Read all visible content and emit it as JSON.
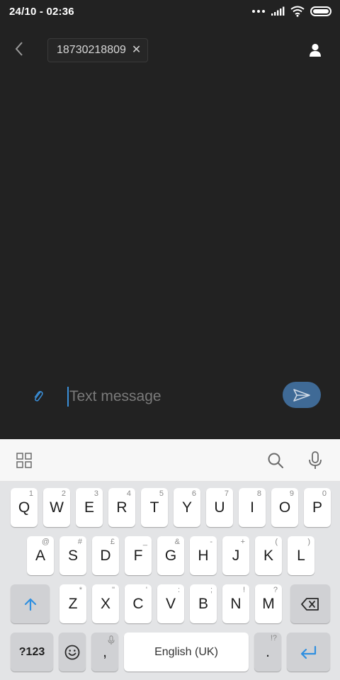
{
  "status_bar": {
    "time": "24/10 - 02:36"
  },
  "header": {
    "recipient": "18730218809",
    "remove_symbol": "✕"
  },
  "composer": {
    "placeholder": "Text message"
  },
  "keyboard": {
    "row1": [
      {
        "key": "Q",
        "sub": "1"
      },
      {
        "key": "W",
        "sub": "2"
      },
      {
        "key": "E",
        "sub": "3"
      },
      {
        "key": "R",
        "sub": "4"
      },
      {
        "key": "T",
        "sub": "5"
      },
      {
        "key": "Y",
        "sub": "6"
      },
      {
        "key": "U",
        "sub": "7"
      },
      {
        "key": "I",
        "sub": "8"
      },
      {
        "key": "O",
        "sub": "9"
      },
      {
        "key": "P",
        "sub": "0"
      }
    ],
    "row2": [
      {
        "key": "A",
        "sub": "@"
      },
      {
        "key": "S",
        "sub": "#"
      },
      {
        "key": "D",
        "sub": "£"
      },
      {
        "key": "F",
        "sub": "_"
      },
      {
        "key": "G",
        "sub": "&"
      },
      {
        "key": "H",
        "sub": "-"
      },
      {
        "key": "J",
        "sub": "+"
      },
      {
        "key": "K",
        "sub": "("
      },
      {
        "key": "L",
        "sub": ")"
      }
    ],
    "row3": [
      {
        "key": "Z",
        "sub": "*"
      },
      {
        "key": "X",
        "sub": "\""
      },
      {
        "key": "C",
        "sub": "'"
      },
      {
        "key": "V",
        "sub": ":"
      },
      {
        "key": "B",
        "sub": ";"
      },
      {
        "key": "N",
        "sub": "!"
      },
      {
        "key": "M",
        "sub": "?"
      }
    ],
    "symbols_label": "?123",
    "comma_label": ",",
    "space_label": "English (UK)",
    "period_label": ".",
    "period_sub": "!?"
  },
  "colors": {
    "background": "#222222",
    "send_button": "#3f6a96",
    "accent_blue": "#2f8fe0",
    "keyboard_bg": "#e3e4e6"
  },
  "icons": {
    "back": "chevron-left",
    "contact": "person",
    "attach": "paperclip",
    "send": "paper-plane",
    "apps": "grid",
    "search": "magnifier",
    "mic": "microphone",
    "shift": "arrow-up",
    "backspace": "backspace",
    "emoji": "smiley",
    "enter": "return-arrow"
  }
}
